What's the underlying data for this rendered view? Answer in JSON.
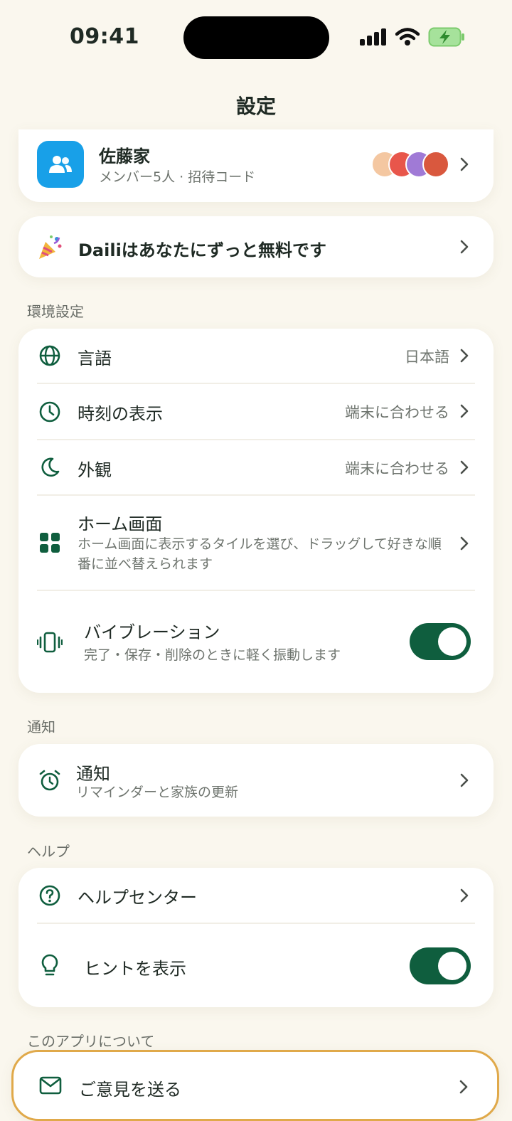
{
  "status": {
    "time": "09:41"
  },
  "header": {
    "title": "設定"
  },
  "family": {
    "name": "佐藤家",
    "sub": "メンバー5人 · 招待コード"
  },
  "promo": {
    "text": "Dailiはあなたにずっと無料です"
  },
  "preferences": {
    "label": "環境設定",
    "language": {
      "title": "言語",
      "value": "日本語"
    },
    "time_display": {
      "title": "時刻の表示",
      "value": "端末に合わせる"
    },
    "appearance": {
      "title": "外観",
      "value": "端末に合わせる"
    },
    "home": {
      "title": "ホーム画面",
      "sub": "ホーム画面に表示するタイルを選び、ドラッグして好きな順番に並べ替えられます"
    },
    "vibration": {
      "title": "バイブレーション",
      "sub": "完了・保存・削除のときに軽く振動します",
      "on": true
    }
  },
  "notifications": {
    "label": "通知",
    "item": {
      "title": "通知",
      "sub": "リマインダーと家族の更新"
    }
  },
  "help": {
    "label": "ヘルプ",
    "center": {
      "title": "ヘルプセンター"
    },
    "tips": {
      "title": "ヒントを表示",
      "on": true
    }
  },
  "about": {
    "label": "このアプリについて",
    "feedback": {
      "title": "ご意見を送る"
    }
  },
  "colors": {
    "accent": "#0F5E3E",
    "background": "#FAF7EE",
    "family_icon": "#18A0E8",
    "highlight_border": "#E0A94A"
  }
}
